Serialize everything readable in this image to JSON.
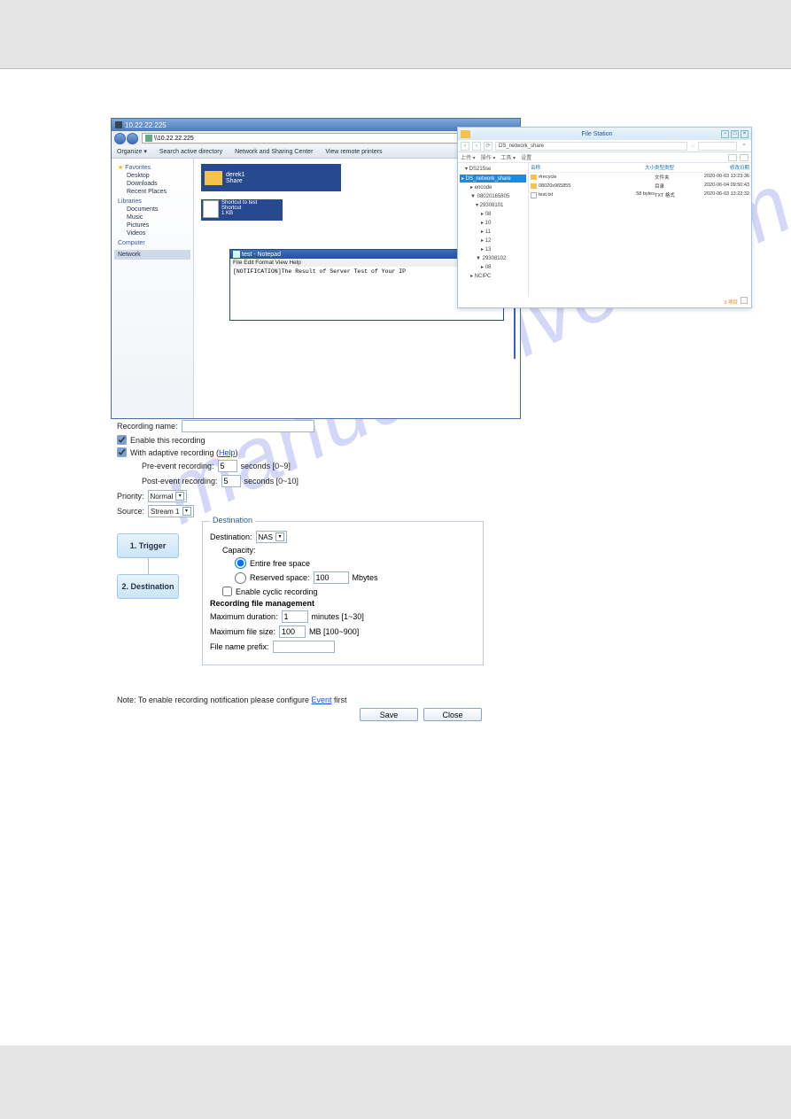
{
  "watermark": "manualshive.com",
  "explorer": {
    "address_ip": "10.22.22.225",
    "address_path": "\\\\10.22.22.225",
    "toolbar": {
      "organize": "Organize  ▾",
      "search_dir": "Search active directory",
      "net_center": "Network and Sharing Center",
      "view_printers": "View remote printers"
    },
    "side": {
      "favorites": "Favorites",
      "desktop": "Desktop",
      "downloads": "Downloads",
      "recent": "Recent Places",
      "libraries": "Libraries",
      "documents": "Documents",
      "music": "Music",
      "pictures": "Pictures",
      "videos": "Videos",
      "computer": "Computer",
      "network": "Network"
    },
    "folder": {
      "name": "derek1",
      "share": "Share"
    },
    "shortcut": {
      "l1": "Shortcut to test",
      "l2": "Shortcut",
      "l3": "1 KB"
    },
    "notepad": {
      "title": "test - Notepad",
      "menu": "File   Edit   Format   View   Help",
      "body": "[NOTIFICATION]The Result of Server Test of Your IP"
    }
  },
  "filestation": {
    "title": "File Station",
    "path": "DS_network_share",
    "toolbar": {
      "a": "上传 ▾",
      "b": "操作 ▾",
      "c": "工具 ▾",
      "d": "设置"
    },
    "tree": {
      "root": "▾ DS215se",
      "sel": "▸ DS_network_share",
      "n2": "▸ encode",
      "n3": "▼ 08020165805",
      "n4": "▾ 29308101",
      "n5": "▸ 08",
      "n6": "▸ 10",
      "n7": "▸ 11",
      "n8": "▸ 12",
      "n9": "▸ 13",
      "n10": "▼ 29308102",
      "n11": "▸ 08",
      "n12": "▸ NCIPC"
    },
    "listhead": {
      "name": "名称",
      "size": "大小",
      "type": "类型类型",
      "date": "修改日期"
    },
    "rows": [
      {
        "name": "#recycle",
        "size": "",
        "type": "文件夹",
        "date": "2020-06-03 13:23:36"
      },
      {
        "name": "08020s965855",
        "size": "",
        "type": "目录",
        "date": "2020-06-04 09:50:43"
      },
      {
        "name": "test.txt",
        "size": "58 bytes",
        "type": "TXT 格式",
        "date": "2020-06-03 13:22:32"
      }
    ],
    "foot": "3 项目"
  },
  "form": {
    "recording_name_label": "Recording name:",
    "recording_name_value": "",
    "enable_recording": "Enable this recording",
    "adaptive": "With adaptive recording (",
    "help": "Help",
    "close_paren": ")",
    "pre_event_label": "Pre-event recording:",
    "pre_event_value": "5",
    "pre_event_suffix": "seconds [0~9]",
    "post_event_label": "Post-event recording:",
    "post_event_value": "5",
    "post_event_suffix": "seconds [0~10]",
    "priority_label": "Priority:",
    "priority_value": "Normal",
    "source_label": "Source:",
    "source_value": "Stream 1",
    "wiz1": "1. Trigger",
    "wiz2": "2. Destination",
    "dest_title": "Destination",
    "dest_label": "Destination:",
    "dest_value": "NAS",
    "capacity": "Capacity:",
    "entire": "Entire free space",
    "reserved": "Reserved space:",
    "reserved_val": "100",
    "reserved_unit": "Mbytes",
    "cyclic": "Enable cyclic recording",
    "rfm": "Recording file management",
    "maxdur": "Maximum duration:",
    "maxdur_val": "1",
    "maxdur_unit": "minutes [1~30]",
    "maxsize": "Maximum file size:",
    "maxsize_val": "100",
    "maxsize_unit": "MB [100~900]",
    "prefix": "File name prefix:",
    "prefix_val": "",
    "note_pre": "Note: To enable recording notification please configure ",
    "note_link": "Event",
    "note_post": " first",
    "save": "Save",
    "close": "Close"
  }
}
